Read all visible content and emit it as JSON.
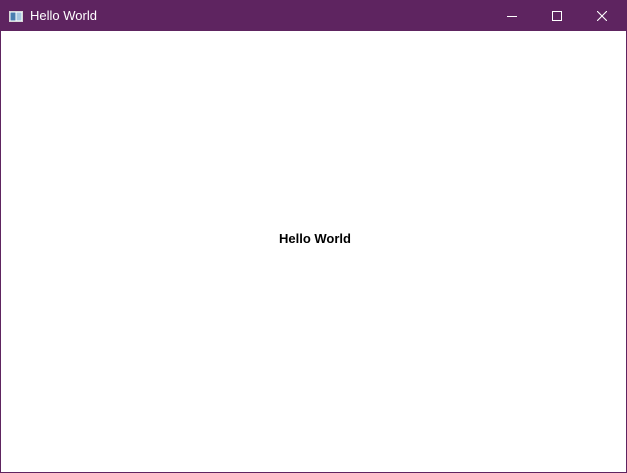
{
  "window": {
    "title": "Hello World",
    "titlebar_color": "#5e2460",
    "icon": "app-window-icon",
    "controls": {
      "minimize_icon": "minimize-icon",
      "maximize_icon": "maximize-icon",
      "close_icon": "close-icon"
    }
  },
  "content": {
    "label": "Hello World"
  }
}
